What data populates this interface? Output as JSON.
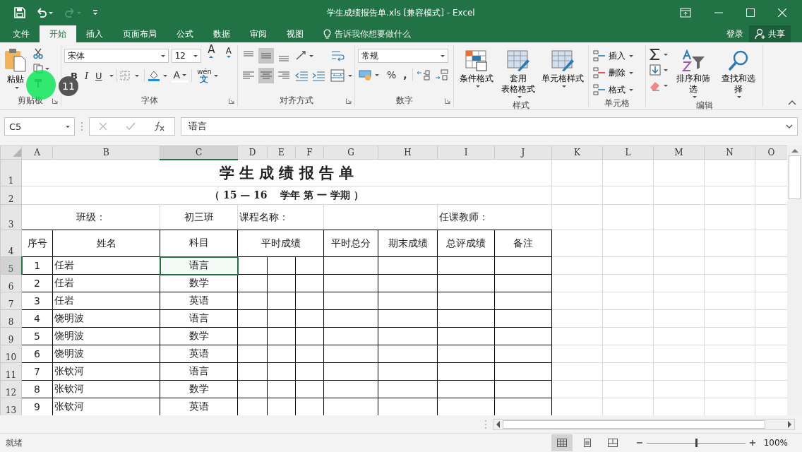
{
  "window": {
    "title": "学生成绩报告单.xls  [兼容模式] - Excel"
  },
  "tabs": [
    {
      "label": "文件",
      "selected": false
    },
    {
      "label": "开始",
      "selected": true
    },
    {
      "label": "插入",
      "selected": false
    },
    {
      "label": "页面布局",
      "selected": false
    },
    {
      "label": "公式",
      "selected": false
    },
    {
      "label": "数据",
      "selected": false
    },
    {
      "label": "审阅",
      "selected": false
    },
    {
      "label": "视图",
      "selected": false
    }
  ],
  "tell_me": {
    "placeholder": "告诉我你想要做什么"
  },
  "account": {
    "sign_in": "登录",
    "share": "共享"
  },
  "ribbon": {
    "groups": [
      {
        "kind": "clipboard",
        "label": "剪贴板",
        "paste": "粘贴"
      },
      {
        "kind": "font",
        "label": "字体",
        "font_name": "宋体",
        "font_size": "12",
        "grow": "A",
        "shrink": "A",
        "bold": "B",
        "italic": "I",
        "underline": "U",
        "font_color": "A",
        "phonetic": "wén",
        "phonetic_sub": "文"
      },
      {
        "kind": "alignment",
        "label": "对齐方式"
      },
      {
        "kind": "number",
        "label": "数字",
        "format": "常规",
        "percent": "%",
        "comma": ","
      },
      {
        "kind": "styles",
        "label": "样式",
        "buttons": [
          {
            "lines": [
              "条件格式"
            ]
          },
          {
            "lines": [
              "套用",
              "表格格式"
            ]
          },
          {
            "lines": [
              "单元格样式"
            ]
          }
        ]
      },
      {
        "kind": "cells",
        "label": "单元格",
        "buttons": [
          "插入",
          "删除",
          "格式"
        ]
      },
      {
        "kind": "editing",
        "label": "编辑",
        "buttons": [
          "排序和筛选",
          "查找和选择"
        ]
      }
    ]
  },
  "click_marker": {
    "step": "11"
  },
  "formula_bar": {
    "name_box": "C5",
    "content": "语言"
  },
  "sheet": {
    "columns": [
      {
        "label": "A",
        "selected": false
      },
      {
        "label": "B",
        "selected": false
      },
      {
        "label": "C",
        "selected": true
      },
      {
        "label": "D",
        "selected": false
      },
      {
        "label": "E",
        "selected": false
      },
      {
        "label": "F",
        "selected": false
      },
      {
        "label": "G",
        "selected": false
      },
      {
        "label": "H",
        "selected": false
      },
      {
        "label": "I",
        "selected": false
      },
      {
        "label": "J",
        "selected": false
      },
      {
        "label": "K",
        "selected": false
      },
      {
        "label": "L",
        "selected": false
      },
      {
        "label": "M",
        "selected": false
      },
      {
        "label": "N",
        "selected": false
      },
      {
        "label": "O",
        "selected": false
      }
    ],
    "row_headers": [
      {
        "label": "1",
        "selected": false
      },
      {
        "label": "2",
        "selected": false
      },
      {
        "label": "3",
        "selected": false
      },
      {
        "label": "4",
        "selected": false
      },
      {
        "label": "5",
        "selected": true
      },
      {
        "label": "6",
        "selected": false
      },
      {
        "label": "7",
        "selected": false
      },
      {
        "label": "8",
        "selected": false
      },
      {
        "label": "9",
        "selected": false
      },
      {
        "label": "10",
        "selected": false
      },
      {
        "label": "11",
        "selected": false
      },
      {
        "label": "12",
        "selected": false
      },
      {
        "label": "13",
        "selected": false
      }
    ],
    "title": "学 生 成 绩 报 告 单",
    "subtitle": "（ 15 — 16　 学年 第 一 学期 ）",
    "class_label": "班级：",
    "class_value": "初三班",
    "course_label": "课程名称：",
    "teacher_label": "任课教师：",
    "headers": [
      "序号",
      "姓名",
      "科目",
      "平时成绩",
      "平时总分",
      "期末成绩",
      "总评成绩",
      "备注"
    ],
    "records": [
      {
        "no": "1",
        "name": "任岩",
        "subject": "语言",
        "selected": true
      },
      {
        "no": "2",
        "name": "任岩",
        "subject": "数学",
        "selected": false
      },
      {
        "no": "3",
        "name": "任岩",
        "subject": "英语",
        "selected": false
      },
      {
        "no": "4",
        "name": "饶明波",
        "subject": "语言",
        "selected": false
      },
      {
        "no": "5",
        "name": "饶明波",
        "subject": "数学",
        "selected": false
      },
      {
        "no": "6",
        "name": "饶明波",
        "subject": "英语",
        "selected": false
      },
      {
        "no": "7",
        "name": "张钦河",
        "subject": "语言",
        "selected": false
      },
      {
        "no": "8",
        "name": "张钦河",
        "subject": "数学",
        "selected": false
      },
      {
        "no": "9",
        "name": "张钦河",
        "subject": "英语",
        "selected": false
      }
    ]
  },
  "status_bar": {
    "status": "就绪",
    "views": [
      {
        "kind": "normal",
        "selected": true
      },
      {
        "kind": "page_layout",
        "selected": false
      },
      {
        "kind": "page_break",
        "selected": false
      }
    ],
    "zoom": {
      "level": 0.5,
      "reading": "100%"
    }
  }
}
